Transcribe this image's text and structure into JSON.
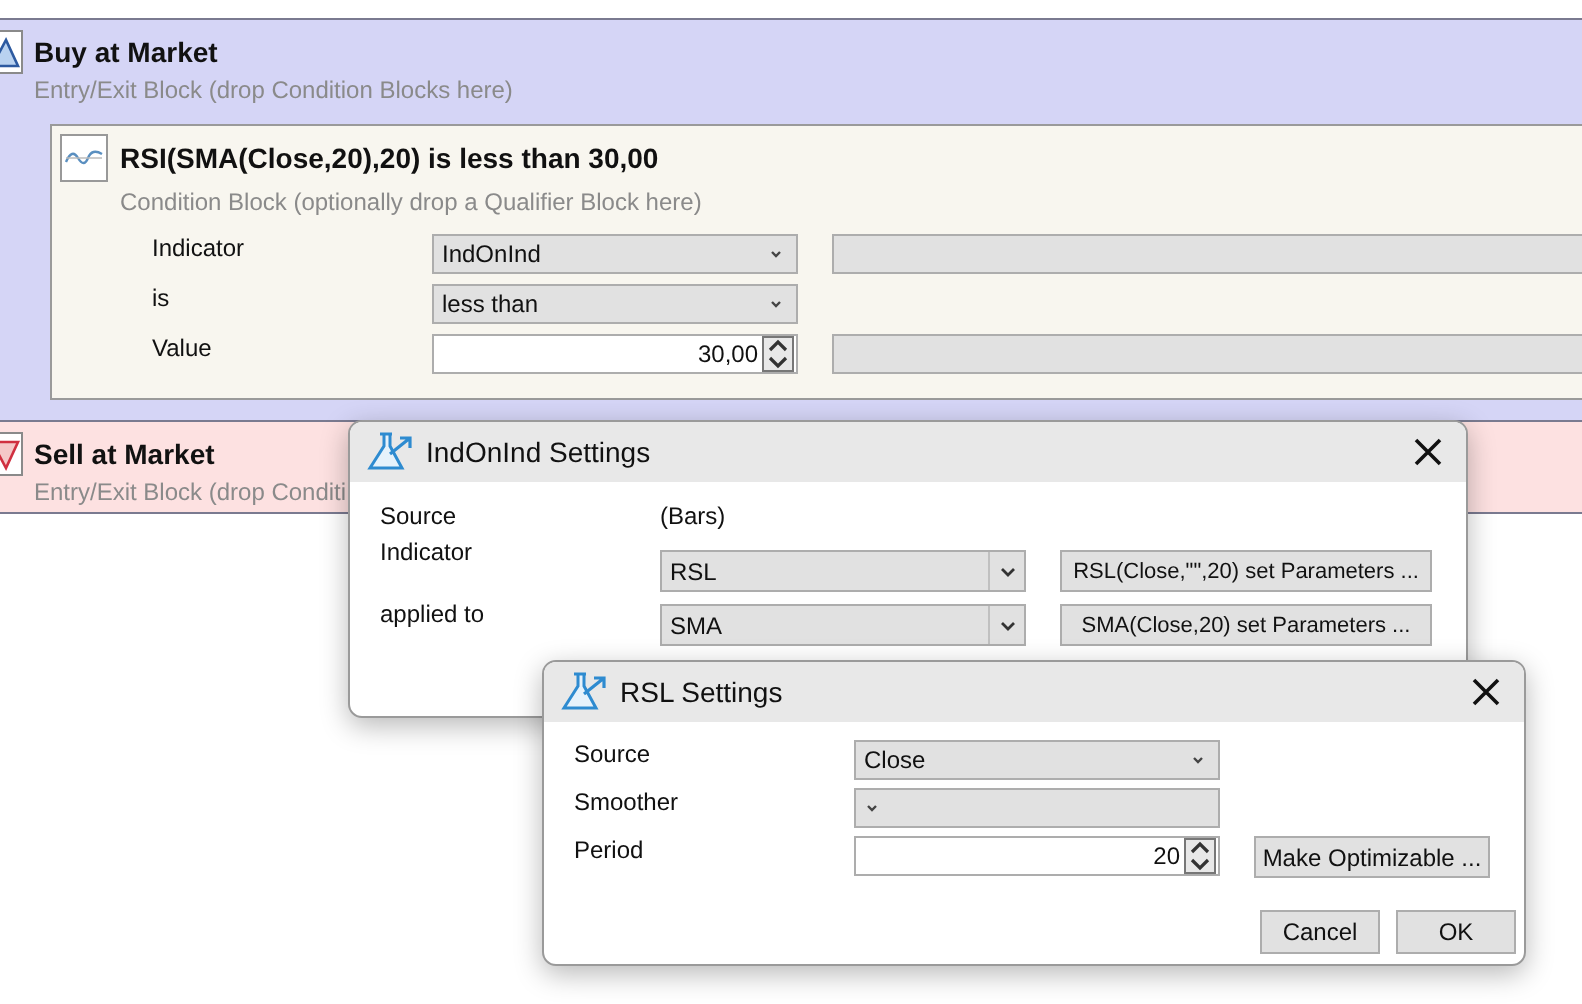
{
  "buy_block": {
    "title": "Buy at Market",
    "subtitle": "Entry/Exit Block (drop Condition Blocks here)",
    "condition": {
      "title": "RSI(SMA(Close,20),20) is less than 30,00",
      "subtitle": "Condition Block (optionally drop a Qualifier Block here)",
      "rows": [
        {
          "kind": "dropdown",
          "label": "Indicator",
          "value": "IndOnInd",
          "side_field": true
        },
        {
          "kind": "dropdown",
          "label": "is",
          "value": "less than",
          "side_field": false
        },
        {
          "kind": "spinner",
          "label": "Value",
          "value": "30,00",
          "side_field": true
        }
      ]
    }
  },
  "sell_block": {
    "title": "Sell at Market",
    "subtitle": "Entry/Exit Block (drop Conditi"
  },
  "indonind_dialog": {
    "title": "IndOnInd Settings",
    "rows": [
      {
        "kind": "text",
        "label": "Source",
        "value": "(Bars)"
      },
      {
        "kind": "dropdown",
        "label": "Indicator",
        "value": "RSL",
        "button": "RSL(Close,\"\",20) set Parameters ..."
      },
      {
        "kind": "dropdown",
        "label": "applied to",
        "value": "SMA",
        "button": "SMA(Close,20) set Parameters ..."
      }
    ]
  },
  "rsl_dialog": {
    "title": "RSL Settings",
    "rows": [
      {
        "kind": "dropdown",
        "label": "Source",
        "value": "Close"
      },
      {
        "kind": "dropdown",
        "label": "Smoother"
      },
      {
        "kind": "spinner",
        "label": "Period",
        "value": "20",
        "button": "Make Optimizable ..."
      }
    ],
    "buttons": [
      "Cancel",
      "OK"
    ]
  }
}
